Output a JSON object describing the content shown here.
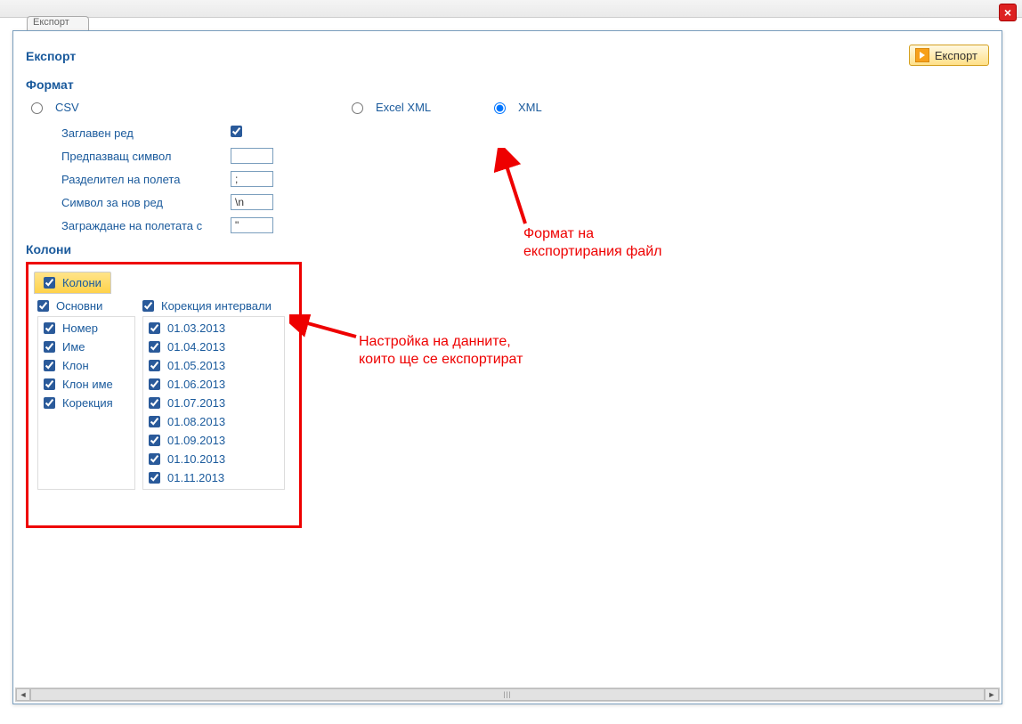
{
  "window": {
    "tab_stub": "Експорт",
    "close_icon": "×"
  },
  "header": {
    "title": "Експорт",
    "export_btn": "Експорт"
  },
  "format": {
    "title": "Формат",
    "csv_label": "CSV",
    "excel_label": "Excel XML",
    "xml_label": "XML",
    "csv_options": {
      "header_row": "Заглавен ред",
      "header_row_checked": true,
      "escape_symbol": "Предпазващ символ",
      "escape_symbol_val": "",
      "field_sep": "Разделител на полета",
      "field_sep_val": ";",
      "newline": "Символ за нов ред",
      "newline_val": "\\n",
      "enclosure": "Заграждане на полетата с",
      "enclosure_val": "\""
    }
  },
  "columns": {
    "title": "Колони",
    "tab_label": "Колони",
    "group_basic": "Основни",
    "group_intervals": "Корекция интервали",
    "basic": [
      "Номер",
      "Име",
      "Клон",
      "Клон име",
      "Корекция"
    ],
    "intervals": [
      "01.03.2013",
      "01.04.2013",
      "01.05.2013",
      "01.06.2013",
      "01.07.2013",
      "01.08.2013",
      "01.09.2013",
      "01.10.2013",
      "01.11.2013"
    ]
  },
  "annotations": {
    "format_note_l1": "Формат на",
    "format_note_l2": "експортирания файл",
    "columns_note_l1": "Настройка на данните,",
    "columns_note_l2": "които ще се експортират"
  }
}
